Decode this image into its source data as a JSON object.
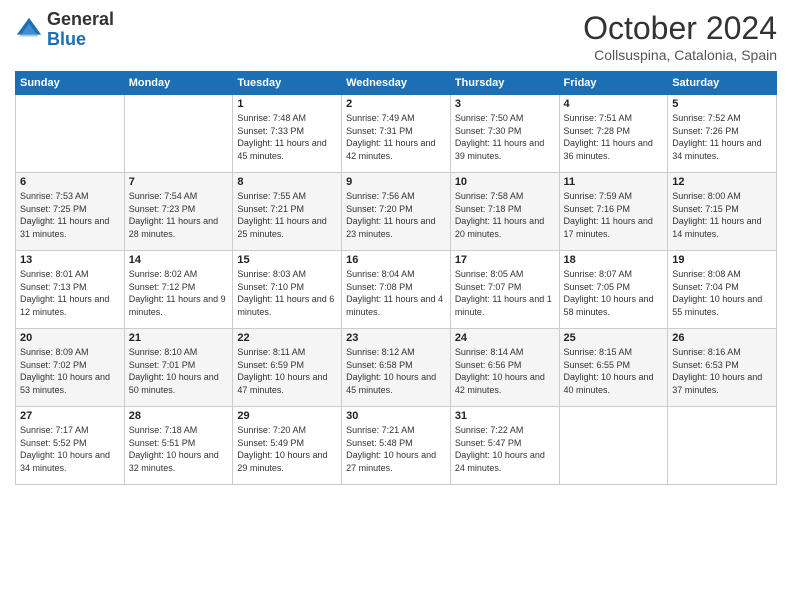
{
  "logo": {
    "general": "General",
    "blue": "Blue"
  },
  "header": {
    "month": "October 2024",
    "location": "Collsuspina, Catalonia, Spain"
  },
  "days_of_week": [
    "Sunday",
    "Monday",
    "Tuesday",
    "Wednesday",
    "Thursday",
    "Friday",
    "Saturday"
  ],
  "weeks": [
    [
      {
        "day": "",
        "sunrise": "",
        "sunset": "",
        "daylight": ""
      },
      {
        "day": "",
        "sunrise": "",
        "sunset": "",
        "daylight": ""
      },
      {
        "day": "1",
        "sunrise": "Sunrise: 7:48 AM",
        "sunset": "Sunset: 7:33 PM",
        "daylight": "Daylight: 11 hours and 45 minutes."
      },
      {
        "day": "2",
        "sunrise": "Sunrise: 7:49 AM",
        "sunset": "Sunset: 7:31 PM",
        "daylight": "Daylight: 11 hours and 42 minutes."
      },
      {
        "day": "3",
        "sunrise": "Sunrise: 7:50 AM",
        "sunset": "Sunset: 7:30 PM",
        "daylight": "Daylight: 11 hours and 39 minutes."
      },
      {
        "day": "4",
        "sunrise": "Sunrise: 7:51 AM",
        "sunset": "Sunset: 7:28 PM",
        "daylight": "Daylight: 11 hours and 36 minutes."
      },
      {
        "day": "5",
        "sunrise": "Sunrise: 7:52 AM",
        "sunset": "Sunset: 7:26 PM",
        "daylight": "Daylight: 11 hours and 34 minutes."
      }
    ],
    [
      {
        "day": "6",
        "sunrise": "Sunrise: 7:53 AM",
        "sunset": "Sunset: 7:25 PM",
        "daylight": "Daylight: 11 hours and 31 minutes."
      },
      {
        "day": "7",
        "sunrise": "Sunrise: 7:54 AM",
        "sunset": "Sunset: 7:23 PM",
        "daylight": "Daylight: 11 hours and 28 minutes."
      },
      {
        "day": "8",
        "sunrise": "Sunrise: 7:55 AM",
        "sunset": "Sunset: 7:21 PM",
        "daylight": "Daylight: 11 hours and 25 minutes."
      },
      {
        "day": "9",
        "sunrise": "Sunrise: 7:56 AM",
        "sunset": "Sunset: 7:20 PM",
        "daylight": "Daylight: 11 hours and 23 minutes."
      },
      {
        "day": "10",
        "sunrise": "Sunrise: 7:58 AM",
        "sunset": "Sunset: 7:18 PM",
        "daylight": "Daylight: 11 hours and 20 minutes."
      },
      {
        "day": "11",
        "sunrise": "Sunrise: 7:59 AM",
        "sunset": "Sunset: 7:16 PM",
        "daylight": "Daylight: 11 hours and 17 minutes."
      },
      {
        "day": "12",
        "sunrise": "Sunrise: 8:00 AM",
        "sunset": "Sunset: 7:15 PM",
        "daylight": "Daylight: 11 hours and 14 minutes."
      }
    ],
    [
      {
        "day": "13",
        "sunrise": "Sunrise: 8:01 AM",
        "sunset": "Sunset: 7:13 PM",
        "daylight": "Daylight: 11 hours and 12 minutes."
      },
      {
        "day": "14",
        "sunrise": "Sunrise: 8:02 AM",
        "sunset": "Sunset: 7:12 PM",
        "daylight": "Daylight: 11 hours and 9 minutes."
      },
      {
        "day": "15",
        "sunrise": "Sunrise: 8:03 AM",
        "sunset": "Sunset: 7:10 PM",
        "daylight": "Daylight: 11 hours and 6 minutes."
      },
      {
        "day": "16",
        "sunrise": "Sunrise: 8:04 AM",
        "sunset": "Sunset: 7:08 PM",
        "daylight": "Daylight: 11 hours and 4 minutes."
      },
      {
        "day": "17",
        "sunrise": "Sunrise: 8:05 AM",
        "sunset": "Sunset: 7:07 PM",
        "daylight": "Daylight: 11 hours and 1 minute."
      },
      {
        "day": "18",
        "sunrise": "Sunrise: 8:07 AM",
        "sunset": "Sunset: 7:05 PM",
        "daylight": "Daylight: 10 hours and 58 minutes."
      },
      {
        "day": "19",
        "sunrise": "Sunrise: 8:08 AM",
        "sunset": "Sunset: 7:04 PM",
        "daylight": "Daylight: 10 hours and 55 minutes."
      }
    ],
    [
      {
        "day": "20",
        "sunrise": "Sunrise: 8:09 AM",
        "sunset": "Sunset: 7:02 PM",
        "daylight": "Daylight: 10 hours and 53 minutes."
      },
      {
        "day": "21",
        "sunrise": "Sunrise: 8:10 AM",
        "sunset": "Sunset: 7:01 PM",
        "daylight": "Daylight: 10 hours and 50 minutes."
      },
      {
        "day": "22",
        "sunrise": "Sunrise: 8:11 AM",
        "sunset": "Sunset: 6:59 PM",
        "daylight": "Daylight: 10 hours and 47 minutes."
      },
      {
        "day": "23",
        "sunrise": "Sunrise: 8:12 AM",
        "sunset": "Sunset: 6:58 PM",
        "daylight": "Daylight: 10 hours and 45 minutes."
      },
      {
        "day": "24",
        "sunrise": "Sunrise: 8:14 AM",
        "sunset": "Sunset: 6:56 PM",
        "daylight": "Daylight: 10 hours and 42 minutes."
      },
      {
        "day": "25",
        "sunrise": "Sunrise: 8:15 AM",
        "sunset": "Sunset: 6:55 PM",
        "daylight": "Daylight: 10 hours and 40 minutes."
      },
      {
        "day": "26",
        "sunrise": "Sunrise: 8:16 AM",
        "sunset": "Sunset: 6:53 PM",
        "daylight": "Daylight: 10 hours and 37 minutes."
      }
    ],
    [
      {
        "day": "27",
        "sunrise": "Sunrise: 7:17 AM",
        "sunset": "Sunset: 5:52 PM",
        "daylight": "Daylight: 10 hours and 34 minutes."
      },
      {
        "day": "28",
        "sunrise": "Sunrise: 7:18 AM",
        "sunset": "Sunset: 5:51 PM",
        "daylight": "Daylight: 10 hours and 32 minutes."
      },
      {
        "day": "29",
        "sunrise": "Sunrise: 7:20 AM",
        "sunset": "Sunset: 5:49 PM",
        "daylight": "Daylight: 10 hours and 29 minutes."
      },
      {
        "day": "30",
        "sunrise": "Sunrise: 7:21 AM",
        "sunset": "Sunset: 5:48 PM",
        "daylight": "Daylight: 10 hours and 27 minutes."
      },
      {
        "day": "31",
        "sunrise": "Sunrise: 7:22 AM",
        "sunset": "Sunset: 5:47 PM",
        "daylight": "Daylight: 10 hours and 24 minutes."
      },
      {
        "day": "",
        "sunrise": "",
        "sunset": "",
        "daylight": ""
      },
      {
        "day": "",
        "sunrise": "",
        "sunset": "",
        "daylight": ""
      }
    ]
  ]
}
